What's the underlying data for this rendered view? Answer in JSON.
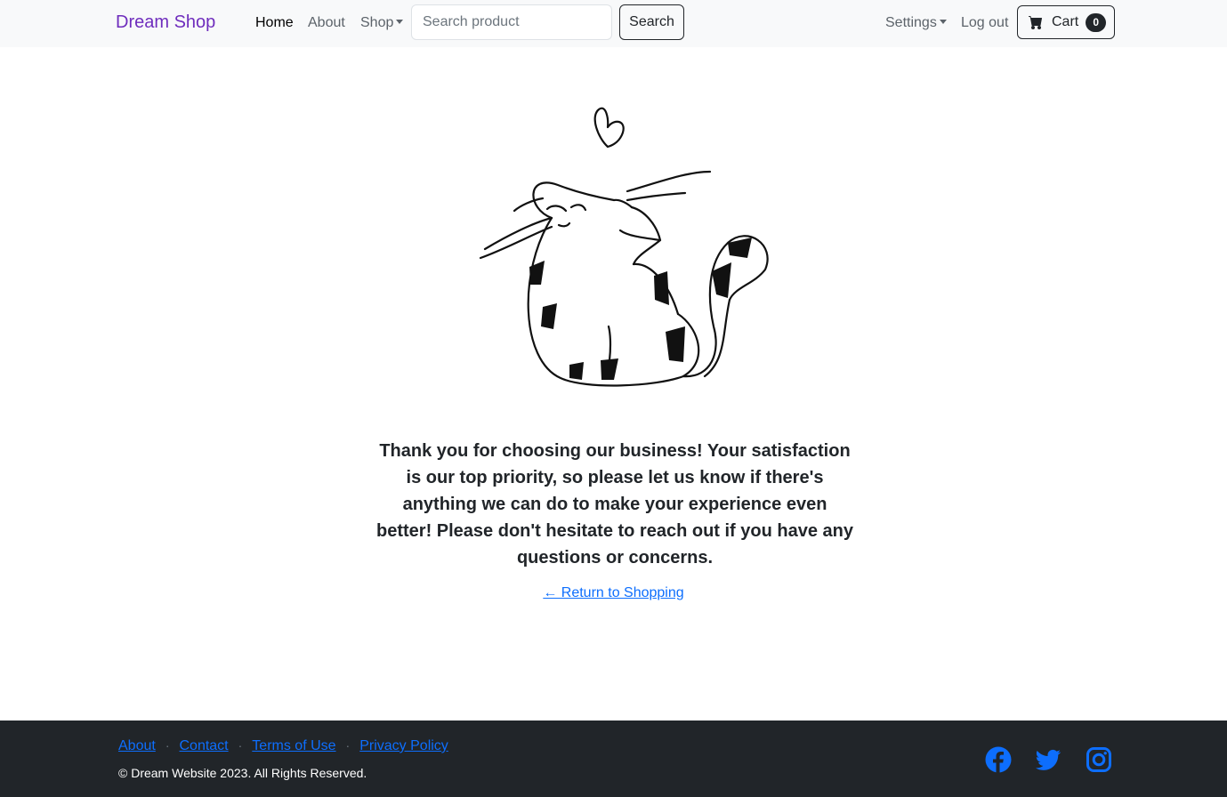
{
  "nav": {
    "brand": "Dream Shop",
    "home": "Home",
    "about": "About",
    "shop": "Shop",
    "search_placeholder": "Search product",
    "search_button": "Search",
    "settings": "Settings",
    "logout": "Log out",
    "cart_label": "Cart",
    "cart_count": "0"
  },
  "main": {
    "message": "Thank you for choosing our business! Your satisfaction is our top priority, so please let us know if there's anything we can do to make your experience even better! Please don't hesitate to reach out if you have any questions or concerns.",
    "return_link": "← Return to Shopping"
  },
  "footer": {
    "links": [
      "About",
      "Contact",
      "Terms of Use",
      "Privacy Policy"
    ],
    "separator": "·",
    "copyright": "© Dream Website 2023. All Rights Reserved.",
    "social_icons": [
      "facebook-icon",
      "twitter-icon",
      "instagram-icon"
    ]
  },
  "colors": {
    "brand": "#6f2dbd",
    "link": "#0d6efd",
    "navbar_bg": "#f8f9fa",
    "footer_bg": "#212529"
  }
}
